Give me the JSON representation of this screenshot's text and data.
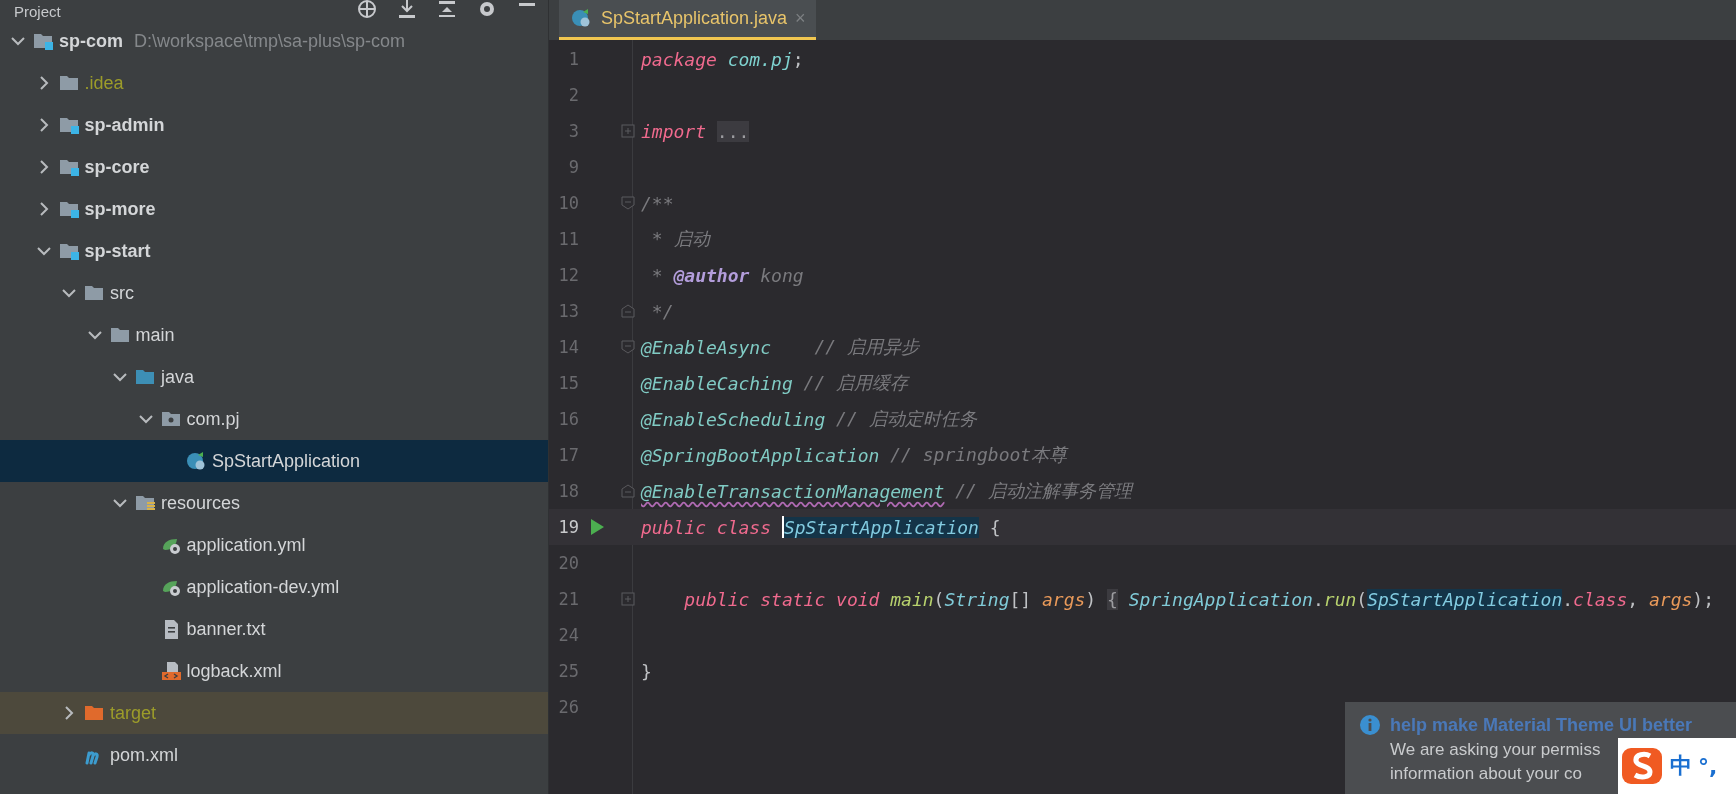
{
  "project_panel": {
    "title": "Project",
    "tree": [
      {
        "label": "sp-com",
        "path": "D:\\workspace\\tmp\\sa-plus\\sp-com",
        "kind": "module",
        "expanded": true,
        "selected": false,
        "ignored": false,
        "children": [
          {
            "label": ".idea",
            "kind": "folder",
            "expanded": false,
            "selected": false,
            "ignored": true
          },
          {
            "label": "sp-admin",
            "kind": "module",
            "expanded": false,
            "selected": false,
            "ignored": false
          },
          {
            "label": "sp-core",
            "kind": "module",
            "expanded": false,
            "selected": false,
            "ignored": false
          },
          {
            "label": "sp-more",
            "kind": "module",
            "expanded": false,
            "selected": false,
            "ignored": false
          },
          {
            "label": "sp-start",
            "kind": "module",
            "expanded": true,
            "selected": false,
            "ignored": false,
            "children": [
              {
                "label": "src",
                "kind": "folder",
                "expanded": true,
                "selected": false,
                "ignored": false,
                "children": [
                  {
                    "label": "main",
                    "kind": "folder",
                    "expanded": true,
                    "selected": false,
                    "ignored": false,
                    "children": [
                      {
                        "label": "java",
                        "kind": "source-folder",
                        "expanded": true,
                        "selected": false,
                        "ignored": false,
                        "children": [
                          {
                            "label": "com.pj",
                            "kind": "package",
                            "expanded": true,
                            "selected": false,
                            "ignored": false,
                            "children": [
                              {
                                "label": "SpStartApplication",
                                "kind": "spring-class",
                                "selected": true,
                                "ignored": false
                              }
                            ]
                          }
                        ]
                      },
                      {
                        "label": "resources",
                        "kind": "resources-folder",
                        "expanded": true,
                        "selected": false,
                        "ignored": false,
                        "children": [
                          {
                            "label": "application.yml",
                            "kind": "spring-config",
                            "selected": false,
                            "ignored": false
                          },
                          {
                            "label": "application-dev.yml",
                            "kind": "spring-config",
                            "selected": false,
                            "ignored": false
                          },
                          {
                            "label": "banner.txt",
                            "kind": "text-file",
                            "selected": false,
                            "ignored": false
                          },
                          {
                            "label": "logback.xml",
                            "kind": "xml-file",
                            "selected": false,
                            "ignored": false
                          }
                        ]
                      }
                    ]
                  }
                ]
              },
              {
                "label": "target",
                "kind": "excluded-folder",
                "expanded": false,
                "selected": false,
                "ignored": true
              },
              {
                "label": "pom.xml",
                "kind": "maven-file",
                "selected": false,
                "ignored": false
              }
            ]
          }
        ]
      }
    ]
  },
  "editor": {
    "tabs": [
      {
        "label": "SpStartApplication.java",
        "close": "×",
        "selected": true
      }
    ],
    "lines": [
      {
        "number": "1",
        "current": false,
        "run": false,
        "fold_start": false,
        "fold_end": false,
        "folded": false,
        "tokens": [
          {
            "kind": "keyword",
            "text": "package"
          },
          {
            "kind": "package",
            "text": " com.pj"
          },
          {
            "kind": "plain",
            "text": ";"
          }
        ]
      },
      {
        "number": "2",
        "current": false,
        "run": false,
        "fold_start": false,
        "fold_end": false,
        "folded": false
      },
      {
        "number": "3",
        "current": false,
        "run": false,
        "fold_start": false,
        "fold_end": false,
        "folded": true,
        "tokens": [
          {
            "kind": "keyword",
            "text": "import "
          },
          {
            "kind": "folded",
            "text": "..."
          }
        ]
      },
      {
        "number": "9",
        "current": false,
        "run": false,
        "fold_start": false,
        "fold_end": false,
        "folded": false
      },
      {
        "number": "10",
        "current": false,
        "run": false,
        "fold_start": true,
        "fold_end": false,
        "folded": false,
        "tokens": [
          {
            "kind": "comment",
            "text": "/**"
          }
        ]
      },
      {
        "number": "11",
        "current": false,
        "run": false,
        "fold_start": false,
        "fold_end": false,
        "folded": false,
        "tokens": [
          {
            "kind": "comment",
            "text": " * 启动"
          }
        ]
      },
      {
        "number": "12",
        "current": false,
        "run": false,
        "fold_start": false,
        "fold_end": false,
        "folded": false,
        "tokens": [
          {
            "kind": "comment",
            "text": " * "
          },
          {
            "kind": "doc-tag",
            "text": "@author"
          },
          {
            "kind": "comment",
            "text": " kong"
          }
        ]
      },
      {
        "number": "13",
        "current": false,
        "run": false,
        "fold_start": false,
        "fold_end": true,
        "folded": false,
        "tokens": [
          {
            "kind": "comment",
            "text": " */"
          }
        ]
      },
      {
        "number": "14",
        "current": false,
        "run": false,
        "fold_start": true,
        "fold_end": false,
        "folded": false,
        "tokens": [
          {
            "kind": "annotation",
            "text": "@EnableAsync"
          },
          {
            "kind": "comment",
            "text": "    // 启用异步"
          }
        ]
      },
      {
        "number": "15",
        "current": false,
        "run": false,
        "fold_start": false,
        "fold_end": false,
        "folded": false,
        "tokens": [
          {
            "kind": "annotation",
            "text": "@EnableCaching"
          },
          {
            "kind": "comment",
            "text": " // 启用缓存"
          }
        ]
      },
      {
        "number": "16",
        "current": false,
        "run": false,
        "fold_start": false,
        "fold_end": false,
        "folded": false,
        "tokens": [
          {
            "kind": "annotation",
            "text": "@EnableScheduling"
          },
          {
            "kind": "comment",
            "text": " // 启动定时任务"
          }
        ]
      },
      {
        "number": "17",
        "current": false,
        "run": false,
        "fold_start": false,
        "fold_end": false,
        "folded": false,
        "tokens": [
          {
            "kind": "annotation",
            "text": "@SpringBootApplication"
          },
          {
            "kind": "comment",
            "text": " // springboot本尊"
          }
        ]
      },
      {
        "number": "18",
        "current": false,
        "run": false,
        "fold_start": false,
        "fold_end": true,
        "folded": false,
        "tokens": [
          {
            "kind": "annotation-warning",
            "text": "@EnableTransactionManagement"
          },
          {
            "kind": "comment",
            "text": " // 启动注解事务管理"
          }
        ]
      },
      {
        "number": "19",
        "current": true,
        "run": true,
        "fold_start": false,
        "fold_end": false,
        "folded": false,
        "tokens": [
          {
            "kind": "keyword",
            "text": "public class "
          },
          {
            "kind": "declaration",
            "text": "SpStartApplication"
          },
          {
            "kind": "plain",
            "text": " {"
          }
        ]
      },
      {
        "number": "20",
        "current": false,
        "run": false,
        "fold_start": false,
        "fold_end": false,
        "folded": false
      },
      {
        "number": "21",
        "current": false,
        "run": false,
        "fold_start": false,
        "fold_end": false,
        "folded": true,
        "tokens": [
          {
            "kind": "keyword",
            "text": "    public static void "
          },
          {
            "kind": "method",
            "text": "main"
          },
          {
            "kind": "plain",
            "text": "("
          },
          {
            "kind": "type",
            "text": "String"
          },
          {
            "kind": "plain",
            "text": "[] "
          },
          {
            "kind": "param",
            "text": "args"
          },
          {
            "kind": "plain",
            "text": ") "
          },
          {
            "kind": "folded",
            "text": "{"
          },
          {
            "kind": "type",
            "text": " SpringApplication"
          },
          {
            "kind": "plain",
            "text": "."
          },
          {
            "kind": "method",
            "text": "run"
          },
          {
            "kind": "plain",
            "text": "("
          },
          {
            "kind": "usage",
            "text": "SpStartApplication"
          },
          {
            "kind": "plain",
            "text": "."
          },
          {
            "kind": "keyword",
            "text": "class"
          },
          {
            "kind": "plain",
            "text": ", "
          },
          {
            "kind": "param",
            "text": "args"
          },
          {
            "kind": "plain",
            "text": ");"
          }
        ]
      },
      {
        "number": "24",
        "current": false,
        "run": false,
        "fold_start": false,
        "fold_end": false,
        "folded": false
      },
      {
        "number": "25",
        "current": false,
        "run": false,
        "fold_start": false,
        "fold_end": false,
        "folded": false,
        "tokens": [
          {
            "kind": "plain",
            "text": "}"
          }
        ]
      },
      {
        "number": "26",
        "current": false,
        "run": false,
        "fold_start": false,
        "fold_end": false,
        "folded": false
      }
    ]
  },
  "notification": {
    "title": "help make Material Theme UI better",
    "lines": [
      "We are asking your permiss",
      "information about your co"
    ]
  },
  "ime_toolbar": {
    "mode": "中",
    "punctuation": "°,"
  }
}
